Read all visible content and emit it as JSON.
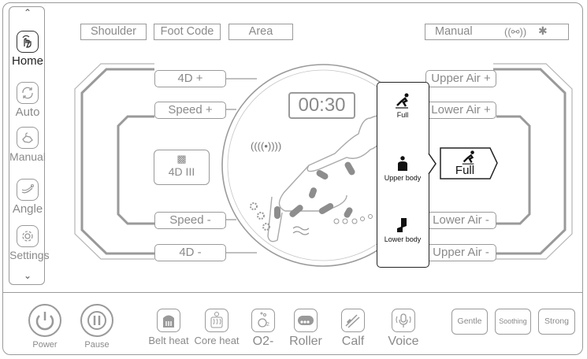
{
  "sidebar": {
    "items": [
      {
        "label": "Home",
        "icon": "hand-tap-icon"
      },
      {
        "label": "Auto",
        "icon": "auto-cycle-icon"
      },
      {
        "label": "Manual",
        "icon": "hand-icon"
      },
      {
        "label": "Angle",
        "icon": "recline-icon"
      },
      {
        "label": "Settings",
        "icon": "gear-icon"
      }
    ]
  },
  "top": {
    "shoulder": "Shoulder",
    "foot_code": "Foot Code",
    "area": "Area",
    "status": "Manual"
  },
  "left": {
    "fourd_plus": "4D +",
    "speed_plus": "Speed +",
    "speed_minus": "Speed -",
    "fourd_minus": "4D -",
    "fourd_level": "4D III"
  },
  "center": {
    "timer": "00:30"
  },
  "right": {
    "upper_air_plus": "Upper Air +",
    "lower_air_plus": "Lower Air +",
    "lower_air_minus": "Lower Air -",
    "upper_air_minus": "Upper Air -",
    "selected_area": "Full"
  },
  "popup": {
    "items": [
      "Full",
      "Upper body",
      "Lower body"
    ]
  },
  "bottom": {
    "power": "Power",
    "pause": "Pause",
    "belt_heat": "Belt heat",
    "core_heat": "Core heat",
    "o2": "O2-",
    "roller": "Roller",
    "calf": "Calf",
    "voice": "Voice",
    "gentle": "Gentle",
    "soothing": "Soothing",
    "strong": "Strong"
  }
}
